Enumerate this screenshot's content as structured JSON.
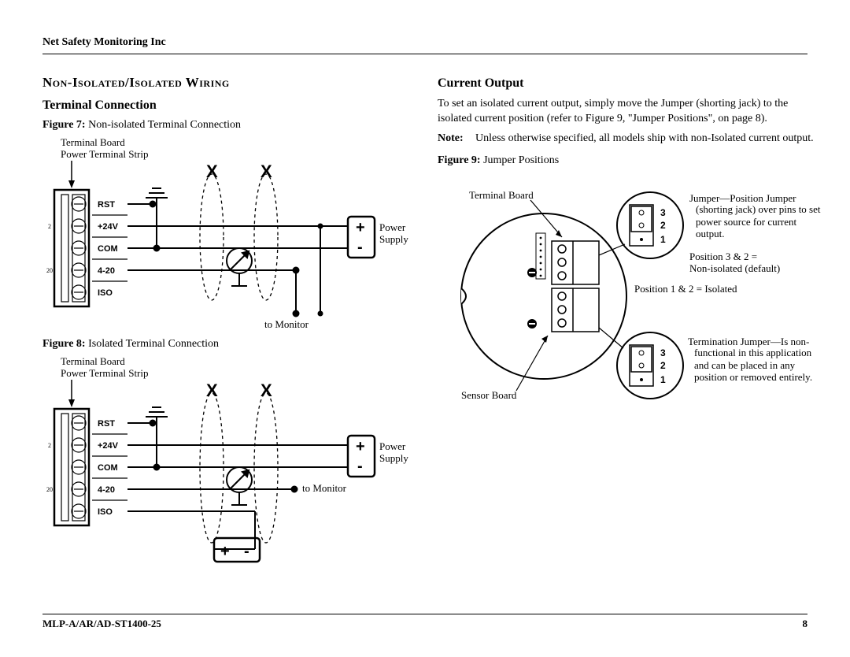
{
  "header": {
    "company": "Net Safety Monitoring Inc"
  },
  "left": {
    "section_title": "Non-Isolated/Isolated Wiring",
    "subtitle": "Terminal Connection",
    "fig7": {
      "caption_label": "Figure 7:",
      "caption_text": "Non-isolated Terminal Connection",
      "tb": "Terminal Board",
      "pts": "Power Terminal Strip",
      "pins": {
        "rst": "RST",
        "p24": "+24V",
        "com": "COM",
        "m420": "4-20",
        "iso": "ISO"
      },
      "num2": "2",
      "num20": "20",
      "power": "Power",
      "supply": "Supply",
      "to_monitor": "to Monitor",
      "X": "X",
      "plus": "+",
      "minus": "-"
    },
    "fig8": {
      "caption_label": "Figure 8:",
      "caption_text": "Isolated Terminal Connection",
      "tb": "Terminal Board",
      "pts": "Power Terminal Strip",
      "pins": {
        "rst": "RST",
        "p24": "+24V",
        "com": "COM",
        "m420": "4-20",
        "iso": "ISO"
      },
      "num2": "2",
      "num20": "20",
      "power": "Power",
      "supply": "Supply",
      "to_monitor": "to Monitor",
      "X": "X",
      "plus": "+",
      "minus": "-"
    }
  },
  "right": {
    "subtitle": "Current Output",
    "para": "To set an isolated current output, simply move the Jumper (shorting jack) to the isolated current position (refer to Figure 9, \"Jumper Positions\", on page 8).",
    "note_label": "Note:",
    "note_text": "Unless otherwise specified, all models ship with non-Isolated current output.",
    "fig9": {
      "caption_label": "Figure 9:",
      "caption_text": "Jumper Positions",
      "terminal_board": "Terminal Board",
      "sensor_board": "Sensor Board",
      "n3": "3",
      "n2": "2",
      "n1": "1",
      "jp_title": "Jumper—Position Jumper",
      "jp_body": "(shorting jack) over pins to set power source for current output.",
      "pos32_a": "Position 3 & 2 =",
      "pos32_b": "Non-isolated (default)",
      "pos12": "Position 1 & 2 = Isolated",
      "tj_title": "Termination Jumper—Is non-",
      "tj_body": "functional in this application and can be placed in any position or removed entirely."
    }
  },
  "footer": {
    "doc": "MLP-A/AR/AD-ST1400-25",
    "page": "8"
  }
}
